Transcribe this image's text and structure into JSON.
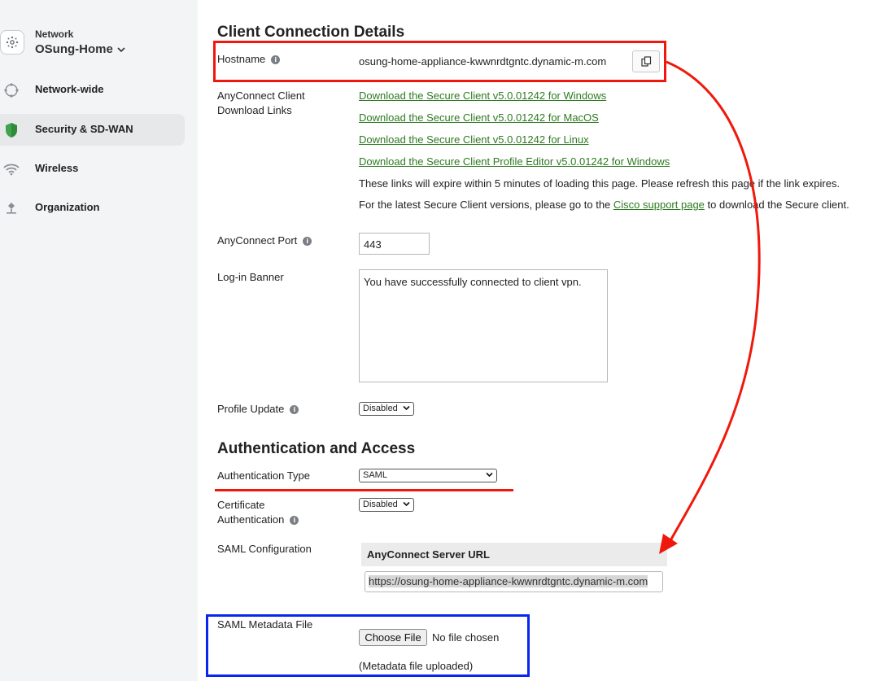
{
  "sidebar": {
    "network_label": "Network",
    "network_name": "OSung-Home",
    "items": [
      {
        "label": "Network-wide",
        "icon": "network-globe-icon"
      },
      {
        "label": "Security & SD-WAN",
        "icon": "shield-icon",
        "active": true
      },
      {
        "label": "Wireless",
        "icon": "wifi-icon"
      },
      {
        "label": "Organization",
        "icon": "organization-icon"
      }
    ]
  },
  "client_connection": {
    "title": "Client Connection Details",
    "hostname_label": "Hostname",
    "hostname_value": "osung-home-appliance-kwwnrdtgntc.dynamic-m.com",
    "download_label_line1": "AnyConnect Client",
    "download_label_line2": "Download Links",
    "links": [
      "Download the Secure Client v5.0.01242 for Windows",
      "Download the Secure Client v5.0.01242 for MacOS",
      "Download the Secure Client v5.0.01242 for Linux",
      "Download the Secure Client Profile Editor v5.0.01242 for Windows"
    ],
    "expire_note": "These links will expire within 5 minutes of loading this page. Please refresh this page if the link expires.",
    "latest_prefix": "For the latest Secure Client versions, please go to the ",
    "latest_link": "Cisco support page",
    "latest_suffix": " to download the Secure client.",
    "port_label": "AnyConnect Port",
    "port_value": "443",
    "banner_label": "Log-in Banner",
    "banner_value": "You have successfully connected to client vpn.",
    "profile_update_label": "Profile Update",
    "profile_update_value": "Disabled"
  },
  "auth": {
    "title": "Authentication and Access",
    "auth_type_label": "Authentication Type",
    "auth_type_value": "SAML",
    "cert_label_line1": "Certificate",
    "cert_label_line2": "Authentication",
    "cert_value": "Disabled",
    "saml_config_label": "SAML Configuration",
    "server_url_header": "AnyConnect Server URL",
    "server_url_value": "https://osung-home-appliance-kwwnrdtgntc.dynamic-m.com",
    "metadata_label": "SAML Metadata File",
    "choose_file": "Choose File",
    "no_file": "No file chosen",
    "uploaded_note": "(Metadata file uploaded)"
  },
  "colors": {
    "link": "#2d7a1f",
    "annotation_red": "#f0180c",
    "annotation_blue": "#0a26ee",
    "shield_green": "#3fa34d"
  }
}
